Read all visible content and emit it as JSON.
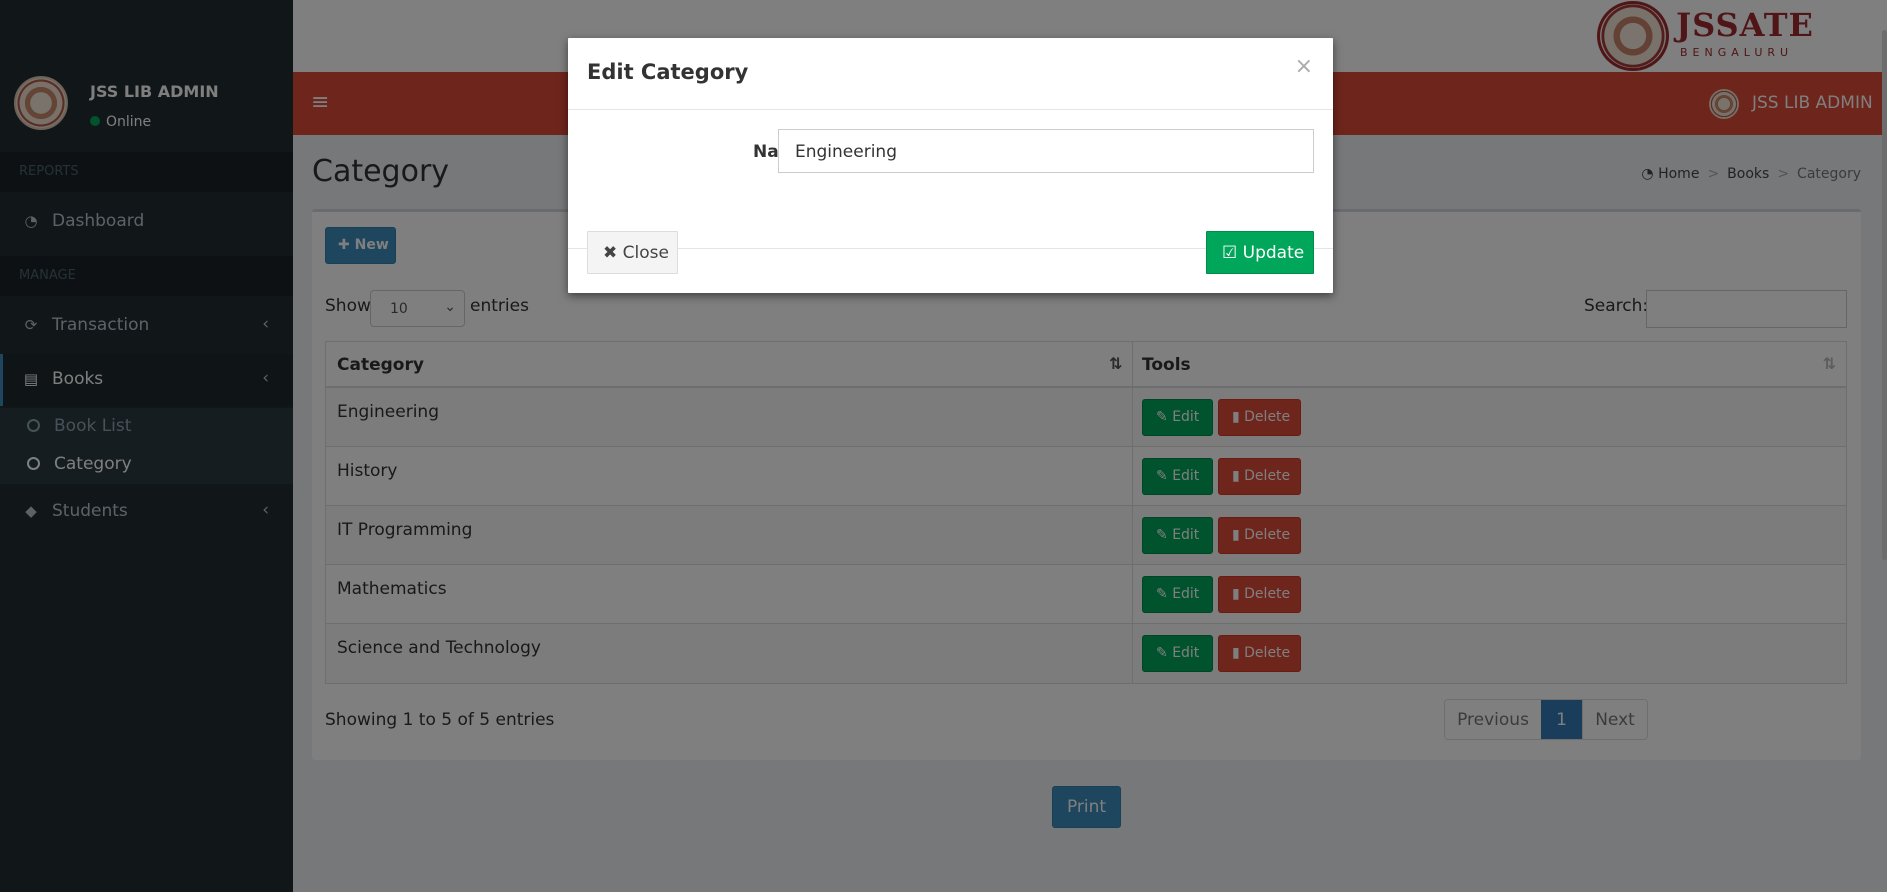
{
  "sidebar": {
    "user_name": "JSS LIB ADMIN",
    "status": "Online",
    "headers": [
      "REPORTS",
      "MANAGE"
    ],
    "items": [
      {
        "label": "Dashboard",
        "icon": "dashboard-icon"
      },
      {
        "label": "Transaction",
        "icon": "refresh-icon"
      },
      {
        "label": "Books",
        "icon": "book-icon"
      },
      {
        "label": "Students",
        "icon": "graduation-cap-icon"
      }
    ],
    "books_submenu": [
      "Book List",
      "Category"
    ]
  },
  "brand": {
    "name": "JSSATE",
    "city": "BENGALURU"
  },
  "navbar": {
    "user_name": "JSS LIB ADMIN"
  },
  "page": {
    "title": "Category",
    "breadcrumb": [
      "Home",
      "Books",
      "Category"
    ]
  },
  "toolbar": {
    "new_label": "New",
    "show_label": "Show",
    "entries_select": "10",
    "entries_label": "entries",
    "search_label": "Search:"
  },
  "table": {
    "columns": [
      "Category",
      "Tools"
    ],
    "rows": [
      {
        "category": "Engineering"
      },
      {
        "category": "History"
      },
      {
        "category": "IT Programming"
      },
      {
        "category": "Mathematics"
      },
      {
        "category": "Science and Technology"
      }
    ],
    "edit_label": "Edit",
    "delete_label": "Delete"
  },
  "footer": {
    "info": "Showing 1 to 5 of 5 entries",
    "prev": "Previous",
    "page": "1",
    "next": "Next",
    "print": "Print"
  },
  "modal": {
    "title": "Edit Category",
    "close_x": "×",
    "name_label": "Name",
    "name_value": "Engineering",
    "close_label": "Close",
    "update_label": "Update"
  },
  "colors": {
    "sidebar_bg": "#222d32",
    "navbar_red": "#dd4b39",
    "primary_blue": "#3c8dbc",
    "success_green": "#00a65a",
    "brand_maroon": "#9e2a2f"
  }
}
